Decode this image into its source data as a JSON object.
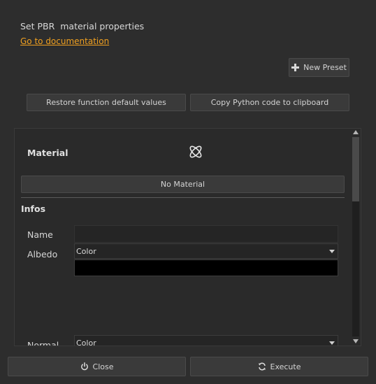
{
  "header": {
    "title": "Set PBR  material properties",
    "doc_link": "Go to documentation"
  },
  "toolbar": {
    "new_preset": "New Preset",
    "restore": "Restore function default values",
    "copy_python": "Copy Python code to clipboard"
  },
  "material": {
    "label": "Material",
    "no_material_button": "No Material"
  },
  "infos": {
    "heading": "Infos",
    "name_label": "Name",
    "name_value": "",
    "albedo_label": "Albedo",
    "albedo_mode": "Color",
    "albedo_color": "#000000",
    "normal_label": "Normal",
    "normal_mode": "Color"
  },
  "footer": {
    "close": "Close",
    "execute": "Execute"
  },
  "colors": {
    "background": "#2d2d2d",
    "link": "#f0a020"
  }
}
